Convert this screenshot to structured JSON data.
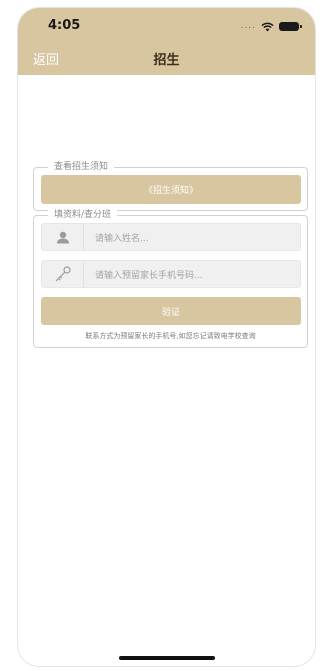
{
  "status_bar": {
    "time": "4:05",
    "signal": "....",
    "icons": [
      "wifi-icon",
      "battery-icon"
    ]
  },
  "nav": {
    "back_label": "返回",
    "title": "招生"
  },
  "notice_section": {
    "legend": "查看招生须知",
    "button_label": "《招生须知》"
  },
  "query_section": {
    "legend": "填资料/查分班",
    "name_input": {
      "placeholder": "请输入姓名...",
      "value": "",
      "icon": "person-icon"
    },
    "phone_input": {
      "placeholder": "请输入预留家长手机号码...",
      "value": "",
      "icon": "key-icon"
    },
    "verify_label": "验证",
    "hint": "联系方式为预留家长的手机号,如您忘记请致电学校查询"
  },
  "colors": {
    "accent": "#d8c6a0",
    "input_bg": "#f0f0f0",
    "border": "#d2d2d2"
  }
}
